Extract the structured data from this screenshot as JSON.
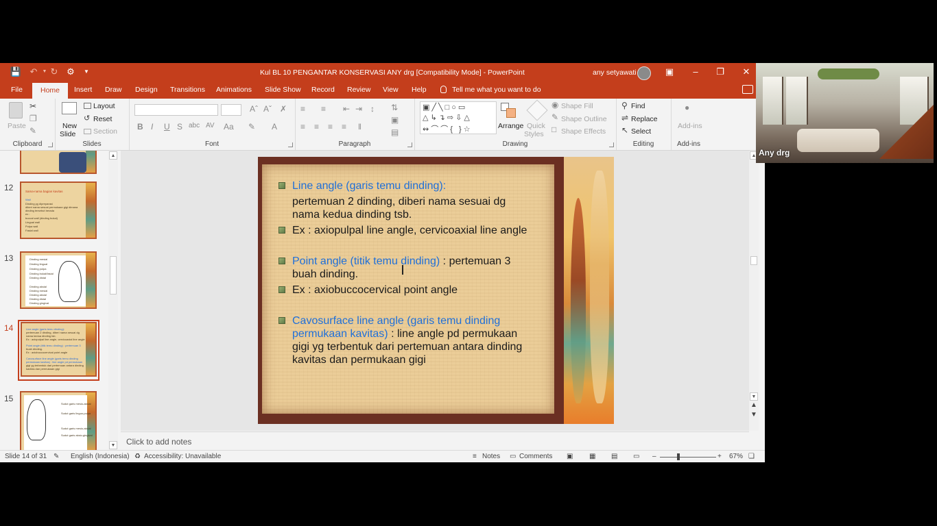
{
  "window": {
    "title": "Kul BL 10 PENGANTAR KONSERVASI ANY drg [Compatibility Mode]  -  PowerPoint",
    "user": "any setyawati",
    "accent": "#c43e1c"
  },
  "tabs": [
    "File",
    "Home",
    "Insert",
    "Draw",
    "Design",
    "Transitions",
    "Animations",
    "Slide Show",
    "Record",
    "Review",
    "View",
    "Help"
  ],
  "tell_me": "Tell me what you want to do",
  "ribbon": {
    "clipboard": {
      "label": "Clipboard",
      "paste": "Paste"
    },
    "slides": {
      "label": "Slides",
      "new_slide_1": "New",
      "new_slide_2": "Slide",
      "layout": "Layout",
      "reset": "Reset",
      "section": "Section"
    },
    "font": {
      "label": "Font",
      "bold": "B",
      "italic": "I",
      "underline": "U",
      "shadow": "S"
    },
    "paragraph": {
      "label": "Paragraph"
    },
    "drawing": {
      "label": "Drawing",
      "arrange": "Arrange",
      "quick_styles_1": "Quick",
      "quick_styles_2": "Styles",
      "shape_fill": "Shape Fill",
      "shape_outline": "Shape Outline",
      "shape_effects": "Shape Effects"
    },
    "editing": {
      "label": "Editing",
      "find": "Find",
      "replace": "Replace",
      "select": "Select"
    },
    "addins": {
      "label": "Add-ins",
      "addins": "Add-ins"
    }
  },
  "thumbnails": [
    {
      "num": "12",
      "title": "Sama-nama bagian kavitas",
      "lines": [
        "Wall",
        "Dinding yg dipreparasi",
        "diberi nama sesuai permukaan gigi dimana",
        "dinding tersebut berada",
        "ex :",
        "buccal wall (dinding bukal)",
        "Lingual wall",
        "Pulpa wall",
        "Fasial wall"
      ]
    },
    {
      "num": "13",
      "lines": [
        "Dinding mesial",
        "Dinding lingual",
        "Dinding pulpa",
        "Dinding bukal/fasial",
        "Dinding distal",
        "Dinding aksial",
        "Dinding mesial",
        "Dinding aksial",
        "Dinding distal",
        "Dinding gingival"
      ]
    },
    {
      "num": "14",
      "lines": [
        "Line angle (garis temu dinding):",
        "pertemuan 2 dinding, diberi nama sesuai dg",
        "nama kedua dinding tsb.",
        "Ex : axiopulpal line angle, cervicoaxial line angle",
        "Point angle (titik temu dinding) : pertemuan 3",
        "buah dinding.",
        "Ex : axiobuccocervical point angle",
        "Cavosurface line angle (garis temu dinding",
        "permukaan kavitas) : line angle pd permukaan",
        "gigi yg terbentuk dari pertemuan antara dinding",
        "kavitas dan permukaan gigi"
      ]
    },
    {
      "num": "15",
      "lines": [
        "Sudut garis mesio-aksial",
        "Sudut garis linguo-pulpa",
        "Sudut garis mesio-aksial",
        "Sudut garis aksio-gingival"
      ]
    }
  ],
  "slide": {
    "lines": [
      {
        "text": "Line angle (garis temu dinding):",
        "style": "blue",
        "bullet": true
      },
      {
        "text": "pertemuan 2 dinding, diberi nama sesuai dg",
        "style": "normal",
        "bullet": false
      },
      {
        "text": "nama kedua dinding tsb.",
        "style": "normal",
        "bullet": false
      },
      {
        "text": "Ex : axiopulpal line angle, cervicoaxial line angle",
        "style": "normal",
        "bullet": true
      },
      {
        "text": "Point angle (titik temu dinding)",
        "style": "blue",
        "bullet": true,
        "suffix": " : pertemuan 3"
      },
      {
        "text": "buah dinding.",
        "style": "normal",
        "bullet": false
      },
      {
        "text": "Ex : axiobuccocervical point angle",
        "style": "normal",
        "bullet": true
      },
      {
        "text": "Cavosurface line angle (garis temu dinding",
        "style": "blue",
        "bullet": true
      },
      {
        "text": "permukaan kavitas)",
        "style": "blue",
        "bullet": false,
        "suffix": " : line angle pd permukaan"
      },
      {
        "text": "gigi yg terbentuk dari pertemuan antara dinding",
        "style": "normal",
        "bullet": false
      },
      {
        "text": "kavitas dan permukaan gigi",
        "style": "normal",
        "bullet": false
      }
    ]
  },
  "notes_placeholder": "Click to add notes",
  "status": {
    "slide": "Slide 14 of 31",
    "language": "English (Indonesia)",
    "accessibility": "Accessibility: Unavailable",
    "notes": "Notes",
    "comments": "Comments",
    "zoom": "67%"
  },
  "webcam": {
    "name": "Any drg"
  }
}
